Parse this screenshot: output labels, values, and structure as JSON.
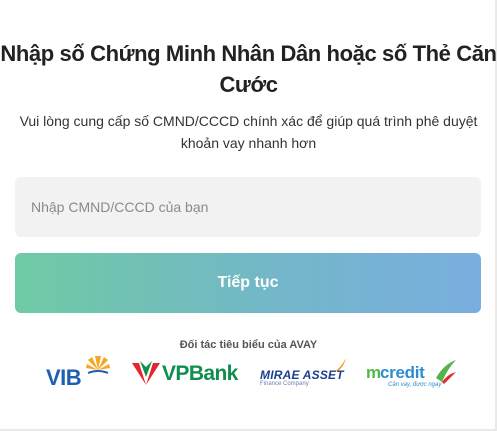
{
  "form": {
    "title_line1": "Nhập số Chứng Minh Nhân Dân hoặc số Thẻ Căn",
    "title_line2": "Cước",
    "subtitle_line1": "Vui lòng cung cấp số CMND/CCCD chính xác để giúp quá trình phê duyệt",
    "subtitle_line2": "khoản vay nhanh hơn",
    "id_input": {
      "placeholder": "Nhập CMND/CCCD của bạn",
      "value": ""
    },
    "continue_label": "Tiếp tục"
  },
  "partners": {
    "heading": "Đối tác tiêu biểu của AVAY",
    "logos": [
      {
        "name": "VIB",
        "text": "VIB",
        "color": "#1f5fb0",
        "accent": "#f5a623"
      },
      {
        "name": "VPBank",
        "text": "VPBank",
        "color": "#0f8e4f",
        "accent": "#e3262f"
      },
      {
        "name": "Mirae Asset",
        "text": "MIRAE ASSET",
        "sub": "Finance Company",
        "color": "#1d3f8f",
        "accent": "#f39200"
      },
      {
        "name": "mcredit",
        "text_m": "m",
        "text_rest": "credit",
        "tagline": "Cần vay, được ngay",
        "color": "#2d8dd0",
        "accent": "#55b44a"
      }
    ]
  }
}
